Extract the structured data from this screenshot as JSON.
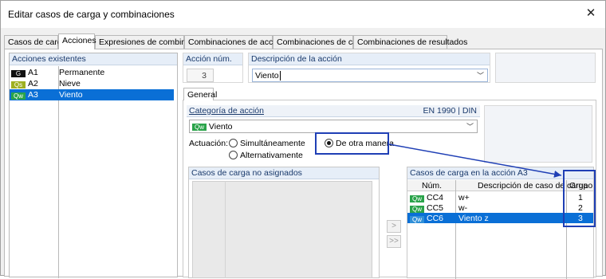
{
  "window": {
    "title": "Editar casos de carga y combinaciones"
  },
  "tabs": [
    "Casos de carga",
    "Acciones",
    "Expresiones de combinación",
    "Combinaciones de acciones",
    "Combinaciones de carga",
    "Combinaciones de resultados"
  ],
  "existing_actions": {
    "header": "Acciones existentes",
    "items": [
      {
        "badge": "G",
        "id": "A1",
        "name": "Permanente",
        "badge_color": "#111111"
      },
      {
        "badge": "Qs",
        "id": "A2",
        "name": "Nieve",
        "badge_color": "#9fb020"
      },
      {
        "badge": "Qw",
        "id": "A3",
        "name": "Viento",
        "badge_color": "#2aa34a",
        "selected": true
      }
    ]
  },
  "action_number": {
    "label": "Acción núm.",
    "value": "3"
  },
  "action_description": {
    "label": "Descripción de la acción",
    "value": "Viento"
  },
  "inner_tab": "General",
  "category": {
    "label": "Categoría de acción",
    "standard": "EN 1990 | DIN",
    "badge": "Qw",
    "value": "Viento"
  },
  "actuation": {
    "label": "Actuación:",
    "options": [
      "Simultáneamente",
      "Alternativamente",
      "De otra manera"
    ],
    "selected": "De otra manera"
  },
  "unassigned": {
    "header": "Casos de carga no asignados"
  },
  "move_buttons": [
    ">",
    ">>"
  ],
  "assigned": {
    "header": "Casos de carga en la acción A3",
    "columns": [
      "Núm.",
      "Descripción de caso de carga",
      "Grupo"
    ],
    "rows": [
      {
        "badge": "Qw",
        "num": "CC4",
        "desc": "w+",
        "group": "1"
      },
      {
        "badge": "Qw",
        "num": "CC5",
        "desc": "w-",
        "group": "2"
      },
      {
        "badge": "Qw",
        "num": "CC6",
        "desc": "Viento z",
        "group": "3",
        "selected": true
      }
    ]
  },
  "colors": {
    "accent": "#0a6fd6",
    "annotation": "#1f3fb5",
    "header_bg": "#e6eef8"
  }
}
